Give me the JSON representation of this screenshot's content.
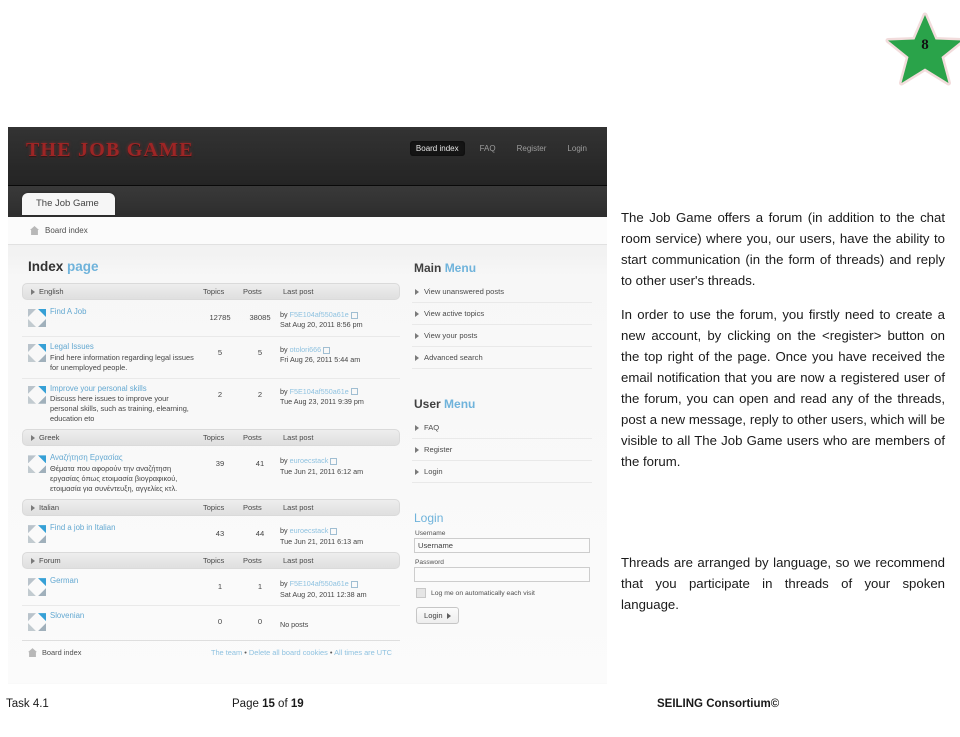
{
  "logo": {
    "badge_number": "8",
    "star_color": "#2aa34a",
    "star_outline": "#f0d8d8"
  },
  "forum": {
    "site_title": "THE JOB GAME",
    "nav": [
      {
        "label": "Board index",
        "active": true
      },
      {
        "label": "FAQ",
        "active": false
      },
      {
        "label": "Register",
        "active": false
      },
      {
        "label": "Login",
        "active": false
      }
    ],
    "tab_label": "The Job Game",
    "breadcrumb": "Board index",
    "page_title_main": "Index",
    "page_title_accent": "page",
    "columns": {
      "topics": "Topics",
      "posts": "Posts",
      "last_post": "Last post"
    },
    "categories": [
      {
        "name": "English",
        "rows": [
          {
            "title": "Find A Job",
            "desc": "",
            "topics": "12785",
            "posts": "38085",
            "last_by": "by",
            "last_user": "F5E104af550a61e",
            "last_date": "Sat Aug 20, 2011 8:56 pm"
          },
          {
            "title": "Legal Issues",
            "desc": "Find here information regarding legal issues for unemployed people.",
            "topics": "5",
            "posts": "5",
            "last_by": "by",
            "last_user": "otolori666",
            "last_date": "Fri Aug 26, 2011 5:44 am"
          },
          {
            "title": "Improve your personal skills",
            "desc": "Discuss here issues to improve your personal skills, such as training, elearning, education eto",
            "topics": "2",
            "posts": "2",
            "last_by": "by",
            "last_user": "F5E104af550a61e",
            "last_date": "Tue Aug 23, 2011 9:39 pm"
          }
        ]
      },
      {
        "name": "Greek",
        "rows": [
          {
            "title": "Αναζήτηση Εργασίας",
            "desc": "Θέματα που αφορούν την αναζήτηση εργασίας όπως ετοιμασία βιογραφικού, ετοιμασία για συνέντευξη, αγγελίες κτλ.",
            "topics": "39",
            "posts": "41",
            "last_by": "by",
            "last_user": "euroecstack",
            "last_date": "Tue Jun 21, 2011 6:12 am"
          }
        ]
      },
      {
        "name": "Italian",
        "rows": [
          {
            "title": "Find a job in Italian",
            "desc": "",
            "topics": "43",
            "posts": "44",
            "last_by": "by",
            "last_user": "euroecstack",
            "last_date": "Tue Jun 21, 2011 6:13 am"
          }
        ]
      },
      {
        "name": "Forum",
        "rows": [
          {
            "title": "German",
            "desc": "",
            "topics": "1",
            "posts": "1",
            "last_by": "by",
            "last_user": "F5E104af550a61e",
            "last_date": "Sat Aug 20, 2011 12:38 am"
          },
          {
            "title": "Slovenian",
            "desc": "",
            "topics": "0",
            "posts": "0",
            "last_by": "",
            "last_user": "",
            "last_date": "",
            "no_posts": "No posts"
          }
        ]
      }
    ],
    "bottom_bar": {
      "board_index": "Board index",
      "team": "The team",
      "delete_cookies": "Delete all board cookies",
      "timezone": "All times are UTC",
      "separator": "•"
    },
    "main_menu": {
      "title_main": "Main",
      "title_accent": "Menu",
      "items": [
        "View unanswered posts",
        "View active topics",
        "View your posts",
        "Advanced search"
      ]
    },
    "user_menu": {
      "title_main": "User",
      "title_accent": "Menu",
      "items": [
        "FAQ",
        "Register",
        "Login"
      ]
    },
    "login_panel": {
      "title": "Login",
      "username_label": "Username",
      "username_value": "Username",
      "password_label": "Password",
      "password_value": "",
      "remember_label": "Log me on automatically each visit",
      "submit_label": "Login"
    }
  },
  "text": {
    "p1": "The Job Game offers a forum (in addition to the chat room service) where you, our users, have the ability to start communication (in the form of threads) and reply to other user's threads.",
    "p2": "In order to use the forum, you firstly need to create a new account, by clicking on the <register> button on the top right of the page. Once you have received the email notification that you are now a registered user of the forum, you can open and read any of the threads, post a new message, reply to other users, which will be visible to all The Job Game users who are members of the forum.",
    "p3": "Threads are arranged by language, so we recommend that you participate in threads of your spoken language."
  },
  "footer": {
    "task": "Task 4.1",
    "page_prefix": "Page ",
    "page_number": "15",
    "page_of": " of ",
    "page_total": "19",
    "consortium": "SEILING Consortium©"
  }
}
